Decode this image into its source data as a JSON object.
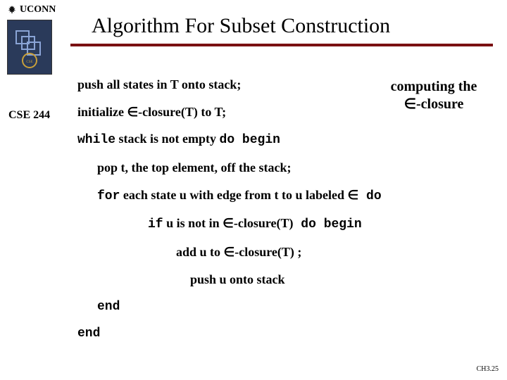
{
  "header": {
    "org": "UCONN",
    "course": "CSE 244",
    "title": "Algorithm For Subset Construction"
  },
  "annotation": {
    "line1": "computing the",
    "line2": "∈-closure"
  },
  "alg": {
    "l1": "push all states in T onto stack;",
    "l2a": "initialize ",
    "l2b": "∈-closure(T) to T;",
    "l3a": "while",
    "l3b": " stack is not empty ",
    "l3c": "do begin",
    "l4": "pop t, the top element, off the stack;",
    "l5a": "for",
    "l5b": " each  state u with edge from t to u labeled ",
    "l5c": "∈",
    "l5d": "  do",
    "l6a": "if",
    "l6b": " u is not in ",
    "l6c": "∈-closure(T)",
    "l6d": "  do begin",
    "l7a": "add u to ",
    "l7b": "∈-closure(T) ;",
    "l8": "push u onto stack",
    "l9": "end",
    "l10": "end"
  },
  "footer": "CH3.25"
}
